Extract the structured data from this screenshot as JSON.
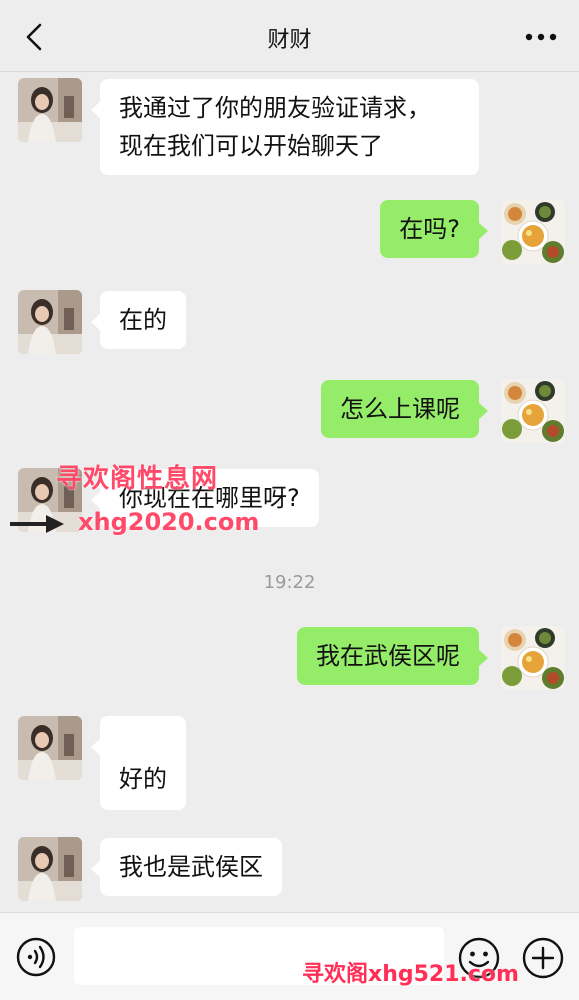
{
  "header": {
    "title": "财财"
  },
  "messages": [
    {
      "side": "in",
      "text": "我通过了你的朋友验证请求，\n现在我们可以开始聊天了"
    },
    {
      "side": "out",
      "text": "在吗?"
    },
    {
      "side": "in",
      "text": "在的"
    },
    {
      "side": "out",
      "text": "怎么上课呢"
    },
    {
      "side": "in",
      "text": "你现在在哪里呀?"
    },
    {
      "side": "out",
      "text": "我在武侯区呢"
    },
    {
      "side": "in",
      "text": "好的"
    },
    {
      "side": "in",
      "text": "我也是武侯区"
    }
  ],
  "timestamp": "19:22",
  "watermarks": {
    "line1": "寻欢阁性息网",
    "line2": "xhg2020.com",
    "footer": "寻欢阁xhg521.com"
  },
  "colors": {
    "background": "#ededed",
    "incoming_bubble": "#ffffff",
    "outgoing_bubble": "#95ec69",
    "watermark": "#ff4a6a"
  },
  "icons": {
    "back": "chevron-left-icon",
    "more": "more-icon",
    "voice": "voice-icon",
    "emoji": "emoji-icon",
    "plus": "plus-icon"
  }
}
